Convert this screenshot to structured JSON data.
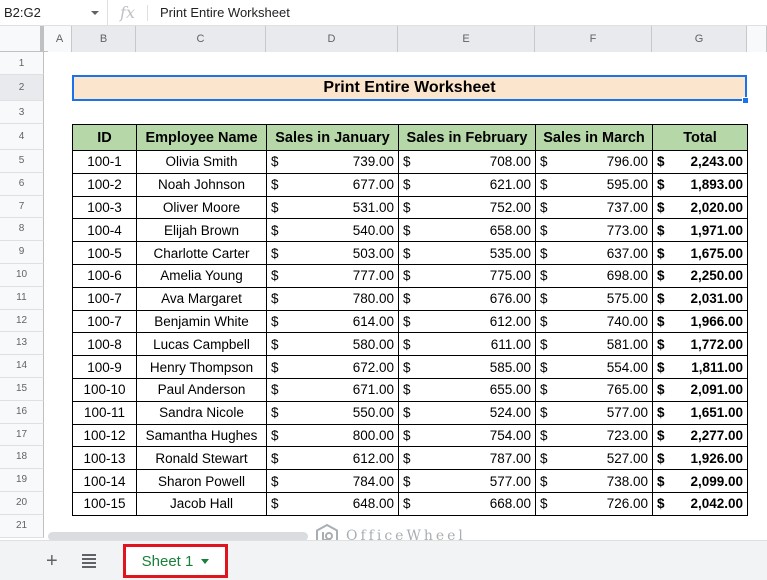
{
  "formula_bar": {
    "name_box": "B2:G2",
    "fx_label": "fx",
    "formula": "Print Entire Worksheet"
  },
  "columns": [
    "A",
    "B",
    "C",
    "D",
    "E",
    "F",
    "G"
  ],
  "rows": [
    "1",
    "2",
    "3",
    "4",
    "5",
    "6",
    "7",
    "8",
    "9",
    "10",
    "11",
    "12",
    "13",
    "14",
    "15",
    "16",
    "17",
    "18",
    "19",
    "20",
    "21"
  ],
  "sheet_title": "Print Entire Worksheet",
  "table": {
    "headers": [
      "ID",
      "Employee Name",
      "Sales in January",
      "Sales in February",
      "Sales in March",
      "Total"
    ],
    "currency_symbol": "$",
    "rows": [
      {
        "id": "100-1",
        "name": "Olivia Smith",
        "jan": "739.00",
        "feb": "708.00",
        "mar": "796.00",
        "total": "2,243.00"
      },
      {
        "id": "100-2",
        "name": "Noah Johnson",
        "jan": "677.00",
        "feb": "621.00",
        "mar": "595.00",
        "total": "1,893.00"
      },
      {
        "id": "100-3",
        "name": "Oliver Moore",
        "jan": "531.00",
        "feb": "752.00",
        "mar": "737.00",
        "total": "2,020.00"
      },
      {
        "id": "100-4",
        "name": "Elijah Brown",
        "jan": "540.00",
        "feb": "658.00",
        "mar": "773.00",
        "total": "1,971.00"
      },
      {
        "id": "100-5",
        "name": "Charlotte Carter",
        "jan": "503.00",
        "feb": "535.00",
        "mar": "637.00",
        "total": "1,675.00"
      },
      {
        "id": "100-6",
        "name": "Amelia Young",
        "jan": "777.00",
        "feb": "775.00",
        "mar": "698.00",
        "total": "2,250.00"
      },
      {
        "id": "100-7",
        "name": "Ava Margaret",
        "jan": "780.00",
        "feb": "676.00",
        "mar": "575.00",
        "total": "2,031.00"
      },
      {
        "id": "100-7",
        "name": "Benjamin White",
        "jan": "614.00",
        "feb": "612.00",
        "mar": "740.00",
        "total": "1,966.00"
      },
      {
        "id": "100-8",
        "name": "Lucas Campbell",
        "jan": "580.00",
        "feb": "611.00",
        "mar": "581.00",
        "total": "1,772.00"
      },
      {
        "id": "100-9",
        "name": "Henry Thompson",
        "jan": "672.00",
        "feb": "585.00",
        "mar": "554.00",
        "total": "1,811.00"
      },
      {
        "id": "100-10",
        "name": "Paul Anderson",
        "jan": "671.00",
        "feb": "655.00",
        "mar": "765.00",
        "total": "2,091.00"
      },
      {
        "id": "100-11",
        "name": "Sandra Nicole",
        "jan": "550.00",
        "feb": "524.00",
        "mar": "577.00",
        "total": "1,651.00"
      },
      {
        "id": "100-12",
        "name": "Samantha Hughes",
        "jan": "800.00",
        "feb": "754.00",
        "mar": "723.00",
        "total": "2,277.00"
      },
      {
        "id": "100-13",
        "name": "Ronald Stewart",
        "jan": "612.00",
        "feb": "787.00",
        "mar": "527.00",
        "total": "1,926.00"
      },
      {
        "id": "100-14",
        "name": "Sharon Powell",
        "jan": "784.00",
        "feb": "577.00",
        "mar": "738.00",
        "total": "2,099.00"
      },
      {
        "id": "100-15",
        "name": "Jacob Hall",
        "jan": "648.00",
        "feb": "668.00",
        "mar": "726.00",
        "total": "2,042.00"
      }
    ]
  },
  "sheet_tabs": [
    {
      "label": "Sheet 1",
      "active": true
    }
  ],
  "watermark": "OfficeWheel",
  "colors": {
    "header_fill": "#b6d7a8",
    "title_fill": "#fce5cd",
    "selection": "#1a73e8",
    "active_tab_text": "#188038",
    "highlight_box": "#e0141e"
  }
}
